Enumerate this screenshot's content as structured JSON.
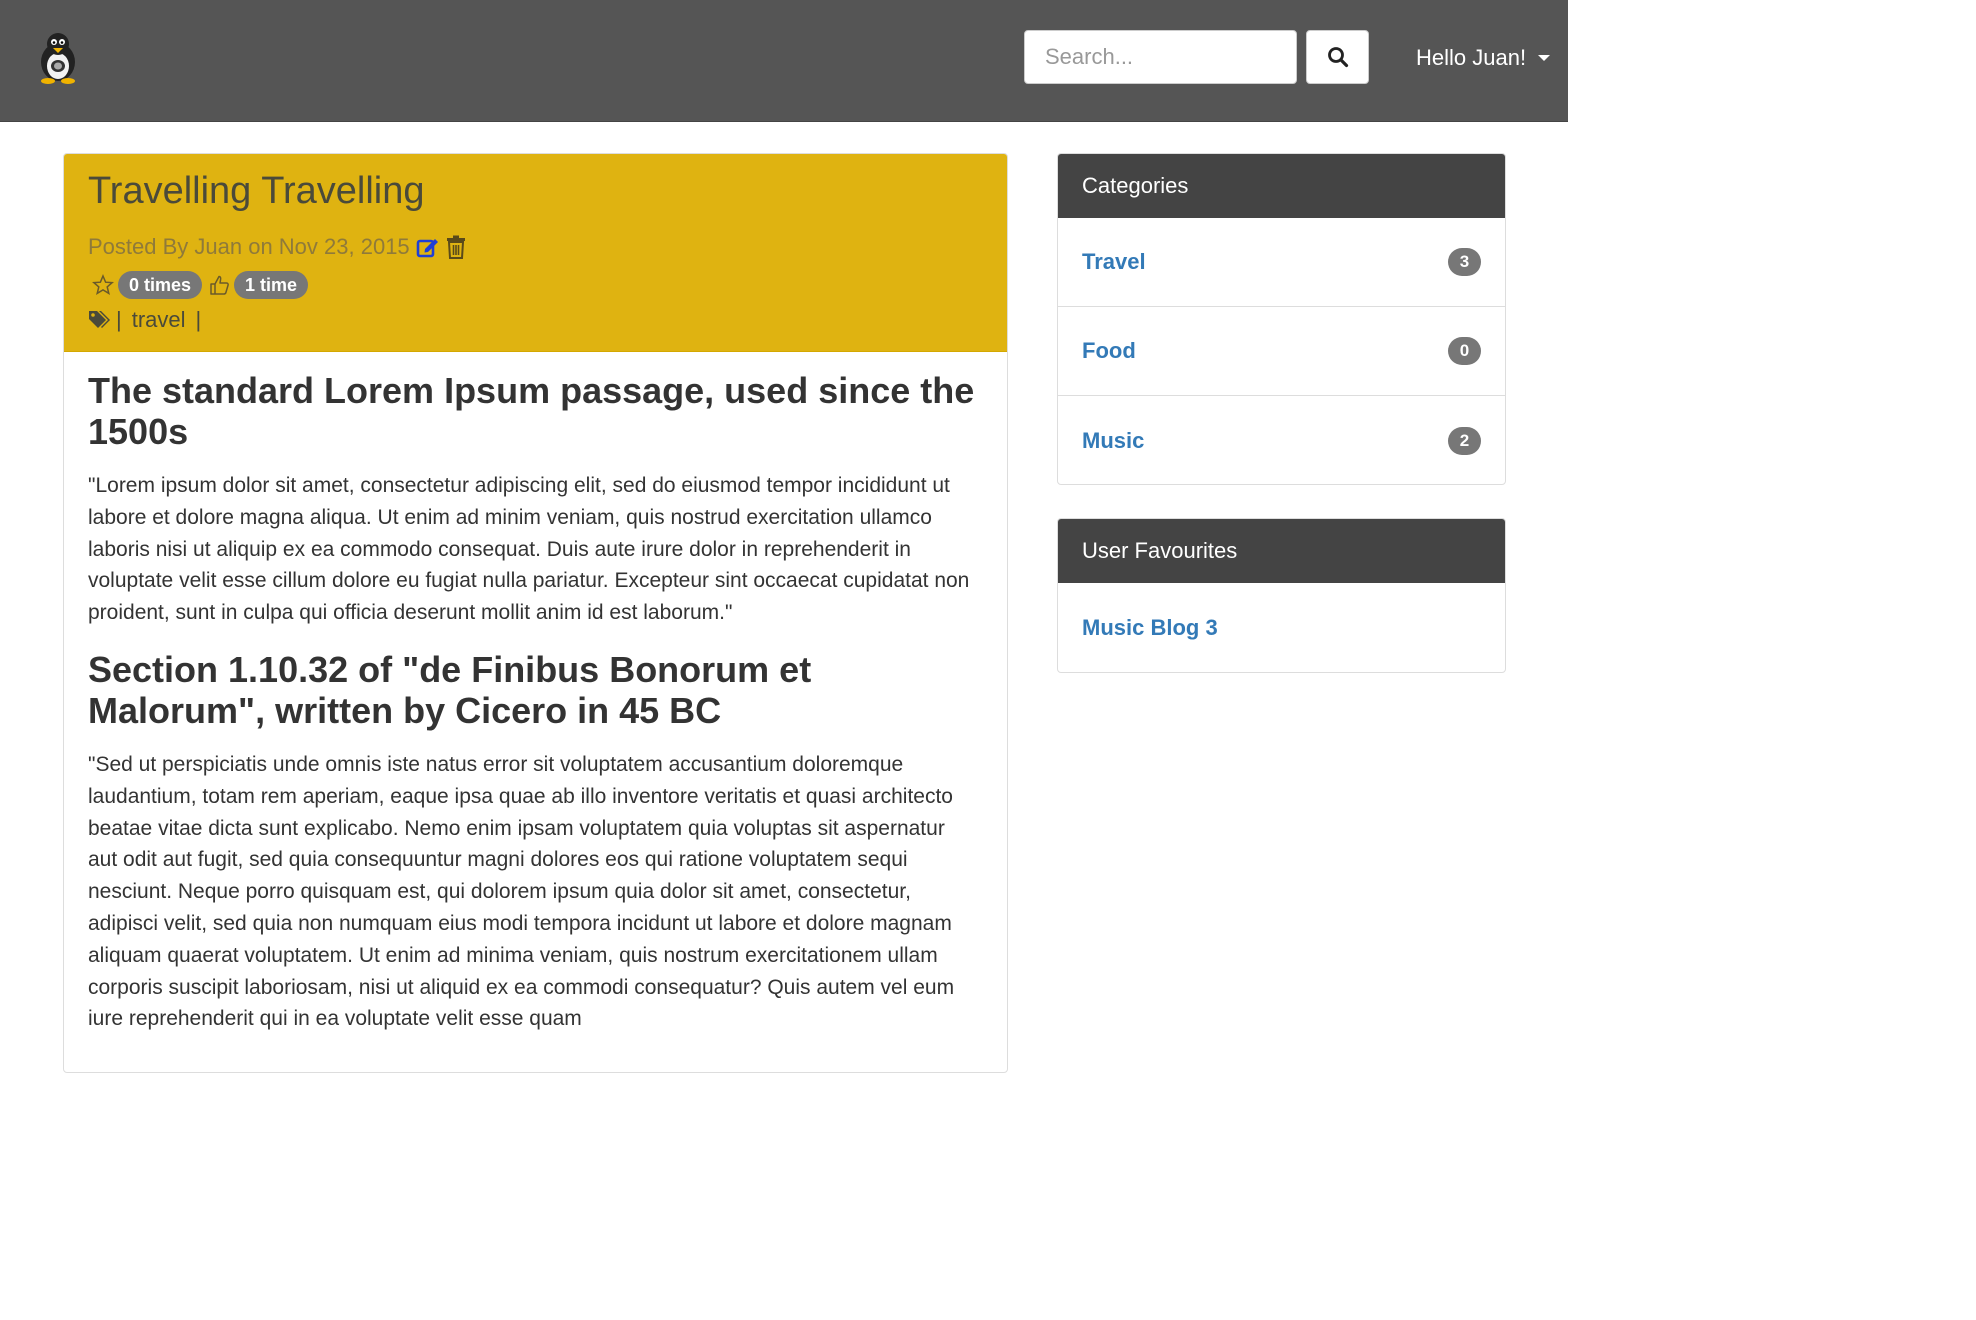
{
  "navbar": {
    "search_placeholder": "Search...",
    "user_label": "Hello Juan!"
  },
  "post": {
    "title": "Travelling Travelling",
    "meta": "Posted By Juan on Nov 23, 2015",
    "favourites_count": "0 times",
    "likes_count": "1 time",
    "tags": [
      "travel"
    ],
    "sections": [
      {
        "heading": "The standard Lorem Ipsum passage, used since the 1500s",
        "text": "\"Lorem ipsum dolor sit amet, consectetur adipiscing elit, sed do eiusmod tempor incididunt ut labore et dolore magna aliqua. Ut enim ad minim veniam, quis nostrud exercitation ullamco laboris nisi ut aliquip ex ea commodo consequat. Duis aute irure dolor in reprehenderit in voluptate velit esse cillum dolore eu fugiat nulla pariatur. Excepteur sint occaecat cupidatat non proident, sunt in culpa qui officia deserunt mollit anim id est laborum.\""
      },
      {
        "heading": "Section 1.10.32 of \"de Finibus Bonorum et Malorum\", written by Cicero in 45 BC",
        "text": "\"Sed ut perspiciatis unde omnis iste natus error sit voluptatem accusantium doloremque laudantium, totam rem aperiam, eaque ipsa quae ab illo inventore veritatis et quasi architecto beatae vitae dicta sunt explicabo. Nemo enim ipsam voluptatem quia voluptas sit aspernatur aut odit aut fugit, sed quia consequuntur magni dolores eos qui ratione voluptatem sequi nesciunt. Neque porro quisquam est, qui dolorem ipsum quia dolor sit amet, consectetur, adipisci velit, sed quia non numquam eius modi tempora incidunt ut labore et dolore magnam aliquam quaerat voluptatem. Ut enim ad minima veniam, quis nostrum exercitationem ullam corporis suscipit laboriosam, nisi ut aliquid ex ea commodi consequatur? Quis autem vel eum iure reprehenderit qui in ea voluptate velit esse quam"
      }
    ]
  },
  "categories": {
    "title": "Categories",
    "items": [
      {
        "label": "Travel",
        "count": "3"
      },
      {
        "label": "Food",
        "count": "0"
      },
      {
        "label": "Music",
        "count": "2"
      }
    ]
  },
  "favourites": {
    "title": "User Favourites",
    "items": [
      {
        "label": "Music Blog 3"
      }
    ]
  },
  "colors": {
    "navbar": "#555555",
    "post_header": "#dfb311",
    "panel_heading": "#444444",
    "link": "#337ab7",
    "badge": "#777777",
    "edit_icon": "#1f3fd6"
  },
  "icons": {
    "logo": "penguin-logo",
    "search": "search-icon",
    "edit": "edit-icon",
    "delete": "trash-icon",
    "favourite": "star-icon",
    "like": "thumbs-up-icon",
    "tags": "tags-icon"
  }
}
